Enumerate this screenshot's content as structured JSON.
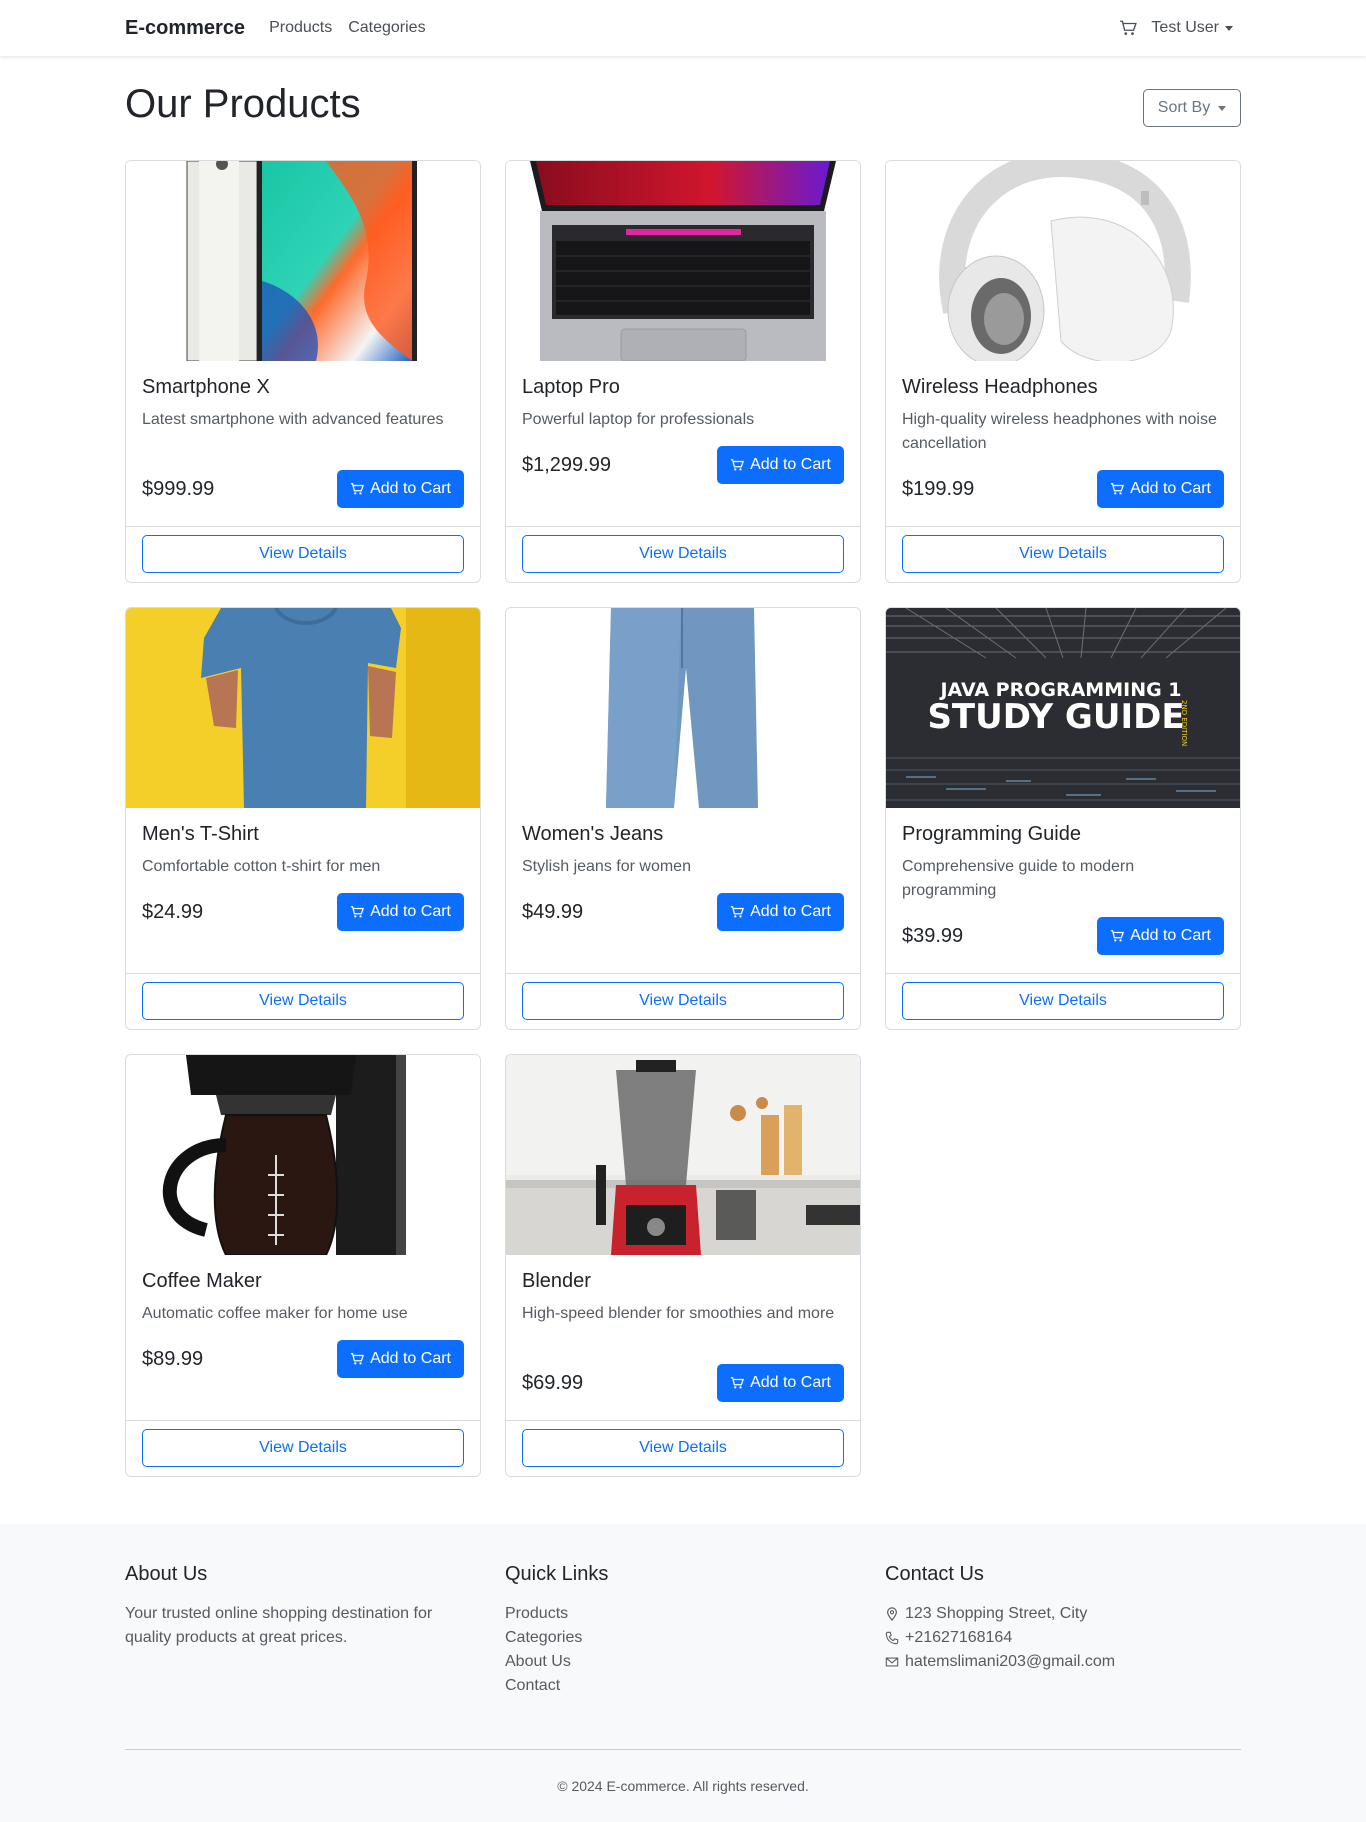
{
  "navbar": {
    "brand": "E-commerce",
    "links": [
      "Products",
      "Categories"
    ],
    "user": "Test User"
  },
  "main": {
    "title": "Our Products",
    "sort_label": "Sort By"
  },
  "products": [
    {
      "name": "Smartphone X",
      "description": "Latest smartphone with advanced features",
      "price": "$999.99",
      "add_label": "Add to Cart",
      "details_label": "View Details"
    },
    {
      "name": "Laptop Pro",
      "description": "Powerful laptop for professionals",
      "price": "$1,299.99",
      "add_label": "Add to Cart",
      "details_label": "View Details"
    },
    {
      "name": "Wireless Headphones",
      "description": "High-quality wireless headphones with noise cancellation",
      "price": "$199.99",
      "add_label": "Add to Cart",
      "details_label": "View Details"
    },
    {
      "name": "Men's T-Shirt",
      "description": "Comfortable cotton t-shirt for men",
      "price": "$24.99",
      "add_label": "Add to Cart",
      "details_label": "View Details"
    },
    {
      "name": "Women's Jeans",
      "description": "Stylish jeans for women",
      "price": "$49.99",
      "add_label": "Add to Cart",
      "details_label": "View Details"
    },
    {
      "name": "Programming Guide",
      "description": "Comprehensive guide to modern programming",
      "price": "$39.99",
      "add_label": "Add to Cart",
      "details_label": "View Details",
      "cover_line1": "JAVA PROGRAMMING 1",
      "cover_line2": "STUDY GUIDE",
      "cover_edition": "2ND EDITION"
    },
    {
      "name": "Coffee Maker",
      "description": "Automatic coffee maker for home use",
      "price": "$89.99",
      "add_label": "Add to Cart",
      "details_label": "View Details"
    },
    {
      "name": "Blender",
      "description": "High-speed blender for smoothies and more",
      "price": "$69.99",
      "add_label": "Add to Cart",
      "details_label": "View Details"
    }
  ],
  "footer": {
    "about_title": "About Us",
    "about_text": "Your trusted online shopping destination for quality products at great prices.",
    "links_title": "Quick Links",
    "links": [
      "Products",
      "Categories",
      "About Us",
      "Contact"
    ],
    "contact_title": "Contact Us",
    "address": "123 Shopping Street, City",
    "phone": "+21627168164",
    "email": "hatemslimani203@gmail.com",
    "copyright": "© 2024 E-commerce. All rights reserved."
  },
  "colors": {
    "primary": "#0d6efd",
    "footer_bg": "#f8f9fa"
  }
}
